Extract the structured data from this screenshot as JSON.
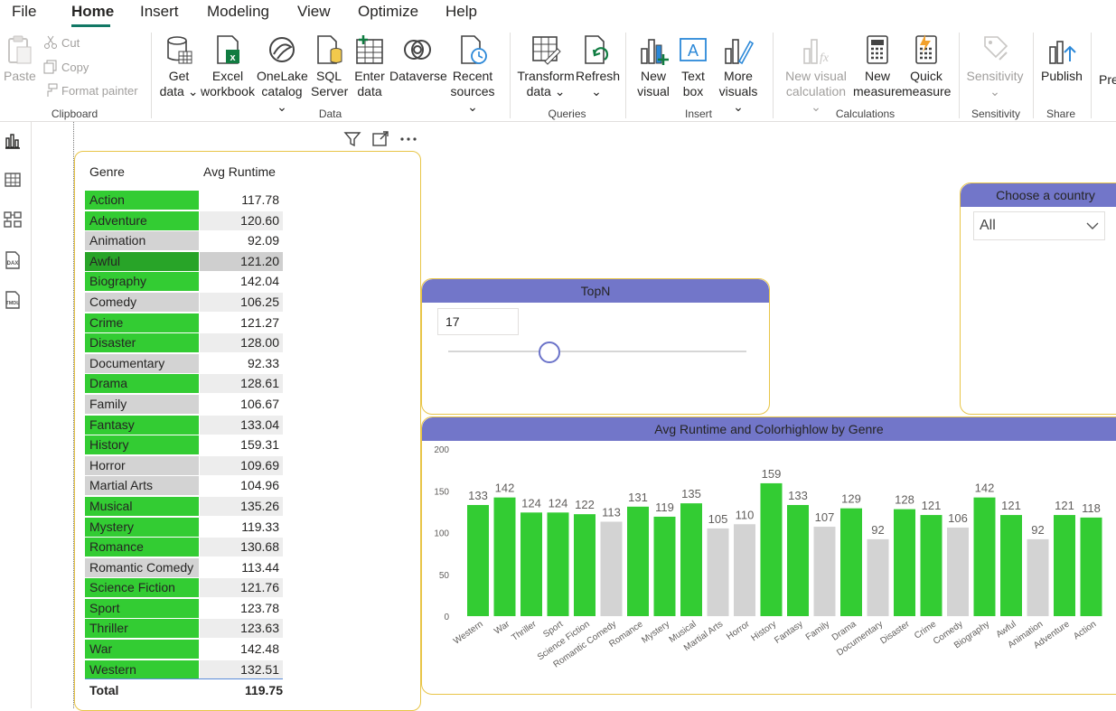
{
  "menu": {
    "items": [
      "File",
      "Home",
      "Insert",
      "Modeling",
      "View",
      "Optimize",
      "Help"
    ],
    "active": "Home"
  },
  "ribbon": {
    "clipboard": {
      "paste": "Paste",
      "cut": "Cut",
      "copy": "Copy",
      "format_painter": "Format painter",
      "label": "Clipboard"
    },
    "data": {
      "get_data": [
        "Get",
        "data ⌄"
      ],
      "excel": [
        "Excel",
        "workbook"
      ],
      "onelake": [
        "OneLake",
        "catalog ⌄"
      ],
      "sql": [
        "SQL",
        "Server"
      ],
      "enter": [
        "Enter",
        "data"
      ],
      "dataverse": [
        "Dataverse"
      ],
      "recent": [
        "Recent",
        "sources ⌄"
      ],
      "label": "Data"
    },
    "queries": {
      "transform": [
        "Transform",
        "data ⌄"
      ],
      "refresh": [
        "Refresh",
        "⌄"
      ],
      "label": "Queries"
    },
    "insert": {
      "new_visual": [
        "New",
        "visual"
      ],
      "text_box": [
        "Text",
        "box"
      ],
      "more_visuals": [
        "More",
        "visuals ⌄"
      ],
      "label": "Insert"
    },
    "calculations": {
      "new_visual_calc": [
        "New visual",
        "calculation ⌄"
      ],
      "new_measure": [
        "New",
        "measure"
      ],
      "quick_measure": [
        "Quick",
        "measure"
      ],
      "label": "Calculations"
    },
    "sensitivity": {
      "btn": [
        "Sensitivity",
        "⌄"
      ],
      "label": "Sensitivity"
    },
    "share": {
      "publish": [
        "Publish"
      ],
      "label": "Share"
    },
    "overflow": "Pre"
  },
  "table": {
    "headers": [
      "Genre",
      "Avg Runtime"
    ],
    "rows": [
      {
        "genre": "Action",
        "value": "117.78",
        "color": "#33cc33"
      },
      {
        "genre": "Adventure",
        "value": "120.60",
        "color": "#33cc33"
      },
      {
        "genre": "Animation",
        "value": "92.09",
        "color": "#d3d3d3"
      },
      {
        "genre": "Awful",
        "value": "121.20",
        "color": "#28a428"
      },
      {
        "genre": "Biography",
        "value": "142.04",
        "color": "#33cc33"
      },
      {
        "genre": "Comedy",
        "value": "106.25",
        "color": "#d3d3d3"
      },
      {
        "genre": "Crime",
        "value": "121.27",
        "color": "#33cc33"
      },
      {
        "genre": "Disaster",
        "value": "128.00",
        "color": "#33cc33"
      },
      {
        "genre": "Documentary",
        "value": "92.33",
        "color": "#d3d3d3"
      },
      {
        "genre": "Drama",
        "value": "128.61",
        "color": "#33cc33"
      },
      {
        "genre": "Family",
        "value": "106.67",
        "color": "#d3d3d3"
      },
      {
        "genre": "Fantasy",
        "value": "133.04",
        "color": "#33cc33"
      },
      {
        "genre": "History",
        "value": "159.31",
        "color": "#33cc33"
      },
      {
        "genre": "Horror",
        "value": "109.69",
        "color": "#d3d3d3"
      },
      {
        "genre": "Martial Arts",
        "value": "104.96",
        "color": "#d3d3d3"
      },
      {
        "genre": "Musical",
        "value": "135.26",
        "color": "#33cc33"
      },
      {
        "genre": "Mystery",
        "value": "119.33",
        "color": "#33cc33"
      },
      {
        "genre": "Romance",
        "value": "130.68",
        "color": "#33cc33"
      },
      {
        "genre": "Romantic Comedy",
        "value": "113.44",
        "color": "#d3d3d3"
      },
      {
        "genre": "Science Fiction",
        "value": "121.76",
        "color": "#33cc33"
      },
      {
        "genre": "Sport",
        "value": "123.78",
        "color": "#33cc33"
      },
      {
        "genre": "Thriller",
        "value": "123.63",
        "color": "#33cc33"
      },
      {
        "genre": "War",
        "value": "142.48",
        "color": "#33cc33"
      },
      {
        "genre": "Western",
        "value": "132.51",
        "color": "#33cc33"
      }
    ],
    "total_label": "Total",
    "total_value": "119.75"
  },
  "topn": {
    "title": "TopN",
    "value": "17",
    "slider_fraction": 0.34
  },
  "country": {
    "title": "Choose a country",
    "selected": "All"
  },
  "chart_data": {
    "type": "bar",
    "title": "Avg Runtime and Colorhighlow by Genre",
    "categories": [
      "Western",
      "War",
      "Thriller",
      "Sport",
      "Science Fiction",
      "Romantic Comedy",
      "Romance",
      "Mystery",
      "Musical",
      "Martial Arts",
      "Horror",
      "History",
      "Fantasy",
      "Family",
      "Drama",
      "Documentary",
      "Disaster",
      "Crime",
      "Comedy",
      "Biography",
      "Awful",
      "Animation",
      "Adventure",
      "Action"
    ],
    "values": [
      133,
      142,
      124,
      124,
      122,
      113,
      131,
      119,
      135,
      105,
      110,
      159,
      133,
      107,
      129,
      92,
      128,
      121,
      106,
      142,
      121,
      92,
      121,
      118
    ],
    "colors": [
      "#33cc33",
      "#33cc33",
      "#33cc33",
      "#33cc33",
      "#33cc33",
      "#d3d3d3",
      "#33cc33",
      "#33cc33",
      "#33cc33",
      "#d3d3d3",
      "#d3d3d3",
      "#33cc33",
      "#33cc33",
      "#d3d3d3",
      "#33cc33",
      "#d3d3d3",
      "#33cc33",
      "#33cc33",
      "#d3d3d3",
      "#33cc33",
      "#33cc33",
      "#d3d3d3",
      "#33cc33",
      "#33cc33"
    ],
    "yticks": [
      0,
      50,
      100,
      150,
      200
    ],
    "ylim": [
      0,
      200
    ],
    "xlabel": "",
    "ylabel": "",
    "grid": false
  }
}
